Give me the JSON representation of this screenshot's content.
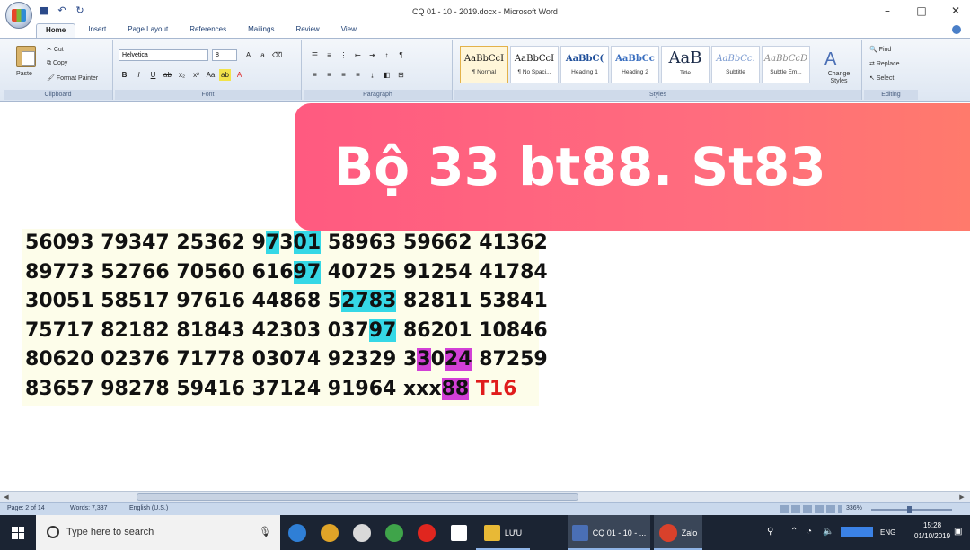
{
  "window": {
    "title": "CQ 01 - 10 - 2019.docx - Microsoft Word",
    "minimize": "–",
    "maximize": "□",
    "close": "✕"
  },
  "ribbon": {
    "tabs": [
      "Home",
      "Insert",
      "Page Layout",
      "References",
      "Mailings",
      "Review",
      "View"
    ],
    "clipboard": {
      "label": "Clipboard",
      "paste": "Paste",
      "cut": "Cut",
      "copy": "Copy",
      "format_painter": "Format Painter"
    },
    "font": {
      "label": "Font",
      "font_name": "Helvetica",
      "font_size": "8"
    },
    "paragraph": {
      "label": "Paragraph"
    },
    "styles": {
      "label": "Styles",
      "items": [
        {
          "sample": "AaBbCcI",
          "name": "¶ Normal"
        },
        {
          "sample": "AaBbCcI",
          "name": "¶ No Spaci..."
        },
        {
          "sample": "AaBbC(",
          "name": "Heading 1"
        },
        {
          "sample": "AaBbCc",
          "name": "Heading 2"
        },
        {
          "sample": "AaB",
          "name": "Title"
        },
        {
          "sample": "AaBbCc.",
          "name": "Subtitle"
        },
        {
          "sample": "AaBbCcD",
          "name": "Subtle Em..."
        }
      ],
      "change_styles": "Change Styles"
    },
    "editing": {
      "label": "Editing",
      "find": "Find",
      "replace": "Replace",
      "select": "Select"
    }
  },
  "banner": {
    "text": "Bộ 33 bt88. St83"
  },
  "document": {
    "rows": [
      [
        {
          "t": "56093 79347 25362 9"
        },
        {
          "t": "7",
          "h": "cy"
        },
        {
          "t": "3"
        },
        {
          "t": "01",
          "h": "cy"
        },
        {
          "t": " 58963 59662 41362"
        }
      ],
      [
        {
          "t": "89773 52766 70560 616"
        },
        {
          "t": "97",
          "h": "cy"
        },
        {
          "t": " 40725 91254 41784"
        }
      ],
      [
        {
          "t": "30051 58517 97616 44868 5"
        },
        {
          "t": "27",
          "h": "cy"
        },
        {
          "t": "83",
          "h": "cy"
        },
        {
          "t": " 82811 53841"
        }
      ],
      [
        {
          "t": "75717 82182 81843 42303 037"
        },
        {
          "t": "97",
          "h": "cy"
        },
        {
          "t": " 86201 10846"
        }
      ],
      [
        {
          "t": "80620 02376 71778 03074 92329 3"
        },
        {
          "t": "3",
          "h": "mg"
        },
        {
          "t": "0"
        },
        {
          "t": "24",
          "h": "mg"
        },
        {
          "t": " 87259"
        }
      ],
      [
        {
          "t": "83657 98278 59416 37124 91964 xxx"
        },
        {
          "t": "88",
          "h": "mg"
        },
        {
          "t": " "
        },
        {
          "t": "T16",
          "h": "red"
        }
      ]
    ]
  },
  "statusbar": {
    "page": "Page: 2 of 14",
    "words": "Words: 7,337",
    "language": "English (U.S.)",
    "zoom": "336%"
  },
  "taskbar": {
    "search_placeholder": "Type here to search",
    "apps": [
      {
        "icon": "edge-icon",
        "color": "#2f7fd6"
      },
      {
        "icon": "chrome-icon",
        "color": "#e0a428"
      },
      {
        "icon": "store-icon",
        "color": "#d9d9d9"
      },
      {
        "icon": "app-icon",
        "color": "#3fa44a"
      },
      {
        "icon": "opera-icon",
        "color": "#e0261f"
      },
      {
        "icon": "file-icon",
        "color": "#ffffff"
      },
      {
        "icon": "folder-icon",
        "color": "#e8b936",
        "label": "LƯU"
      },
      {
        "icon": "word-icon",
        "color": "#4a6fb5",
        "label": "CQ 01 - 10 - ..."
      },
      {
        "icon": "zalo-icon",
        "color": "#d9412b",
        "label": "Zalo"
      }
    ],
    "lang": "ENG",
    "time": "15:28",
    "date": "01/10/2019"
  }
}
